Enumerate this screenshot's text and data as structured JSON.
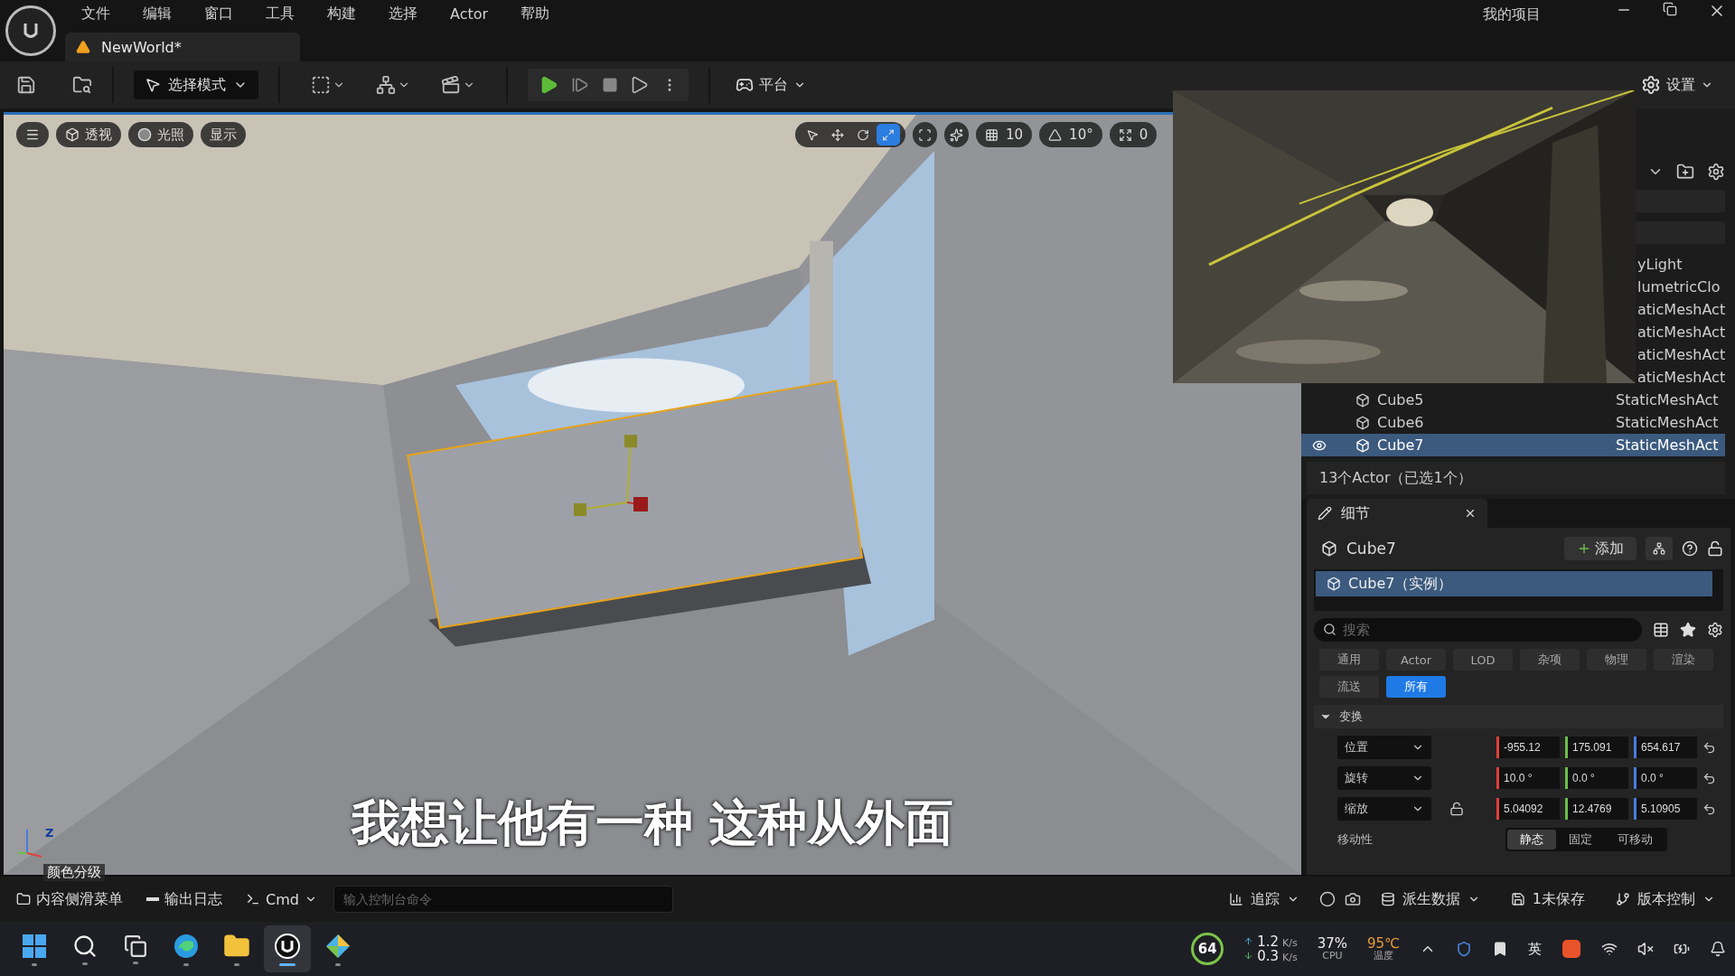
{
  "menu_bar": {
    "items": [
      "文件",
      "编辑",
      "窗口",
      "工具",
      "构建",
      "选择",
      "Actor",
      "帮助"
    ],
    "project": "我的项目"
  },
  "level_tab": {
    "label": "NewWorld*"
  },
  "toolbar": {
    "mode": "选择模式",
    "platform": "平台",
    "settings": "设置"
  },
  "viewport": {
    "buttons": [
      {
        "kind": "menu"
      },
      {
        "kind": "view",
        "label": "透视"
      },
      {
        "kind": "lit",
        "label": "光照"
      },
      {
        "kind": "show",
        "label": "显示"
      }
    ],
    "tools": [
      {
        "kind": "select",
        "selected": false
      },
      {
        "kind": "move",
        "selected": false
      },
      {
        "kind": "rotate",
        "selected": false
      },
      {
        "kind": "scale",
        "selected": true
      }
    ],
    "snaps": [
      {
        "kind": "grid",
        "value": "10"
      },
      {
        "kind": "angle",
        "value": "10°"
      },
      {
        "kind": "scale",
        "value": "0"
      }
    ],
    "axis_label": "Z",
    "subtitle": "我想让他有一种 这种从外面"
  },
  "outliner": {
    "rows": [
      {
        "type": "yLight",
        "selected": false
      },
      {
        "type": "lumetricClo",
        "selected": false
      },
      {
        "type": "aticMeshAct",
        "selected": false
      },
      {
        "type": "aticMeshAct",
        "selected": false
      },
      {
        "type": "aticMeshAct",
        "selected": false
      },
      {
        "type": "aticMeshAct",
        "selected": false
      },
      {
        "name": "Cube5",
        "type": "StaticMeshAct",
        "selected": false
      },
      {
        "name": "Cube6",
        "type": "StaticMeshAct",
        "selected": false
      },
      {
        "name": "Cube7",
        "type": "StaticMeshAct",
        "selected": true
      }
    ],
    "summary": "13个Actor（已选1个）"
  },
  "details": {
    "tab": "细节",
    "actor": "Cube7",
    "add": "添加",
    "component": {
      "label": "Cube7（实例）",
      "selected": true
    },
    "search_placeholder": "搜索",
    "filters": [
      {
        "label": "通用",
        "selected": false
      },
      {
        "label": "Actor",
        "selected": false
      },
      {
        "label": "LOD",
        "selected": false
      },
      {
        "label": "杂项",
        "selected": false
      },
      {
        "label": "物理",
        "selected": false
      },
      {
        "label": "渲染",
        "selected": false
      },
      {
        "label": "流送",
        "selected": false
      },
      {
        "label": "所有",
        "selected": true
      }
    ],
    "section": {
      "title": "变换",
      "expanded": true
    },
    "transform": [
      {
        "label": "位置",
        "values": [
          "-955.12",
          "175.091",
          "654.617"
        ],
        "lock": false
      },
      {
        "label": "旋转",
        "values": [
          "10.0 °",
          "0.0 °",
          "0.0 °"
        ],
        "lock": false
      },
      {
        "label": "缩放",
        "values": [
          "5.04092",
          "12.4769",
          "5.10905"
        ],
        "lock": true
      }
    ],
    "mobility": {
      "label": "移动性",
      "options": [
        {
          "label": "静态",
          "selected": true
        },
        {
          "label": "固定",
          "selected": false
        },
        {
          "label": "可移动",
          "selected": false
        }
      ]
    }
  },
  "status_bar": {
    "floating_label": "颜色分级",
    "tabs": [
      {
        "kind": "drawer",
        "label": "内容侧滑菜单"
      },
      {
        "kind": "log",
        "label": "输出日志"
      }
    ],
    "cmd": "Cmd",
    "console_placeholder": "输入控制台命令",
    "right": [
      {
        "kind": "trace",
        "label": "追踪"
      },
      {
        "kind": "derived",
        "label": "派生数据"
      },
      {
        "kind": "unsaved",
        "label": "1未保存"
      },
      {
        "kind": "vcs",
        "label": "版本控制"
      }
    ]
  },
  "taskbar": {
    "apps": [
      {
        "kind": "start",
        "active": false
      },
      {
        "kind": "search",
        "active": false
      },
      {
        "kind": "taskview",
        "active": false
      },
      {
        "kind": "edge",
        "active": false
      },
      {
        "kind": "explorer",
        "active": false
      },
      {
        "kind": "unreal",
        "active": true
      },
      {
        "kind": "app",
        "active": false
      }
    ],
    "score": "64",
    "upload": "1.2",
    "upload_unit": "K/s",
    "download": "0.3",
    "download_unit": "K/s",
    "cpu": "37%",
    "cpu_label": "CPU",
    "temp": "95℃",
    "temp_label": "温度",
    "ime": "英"
  }
}
